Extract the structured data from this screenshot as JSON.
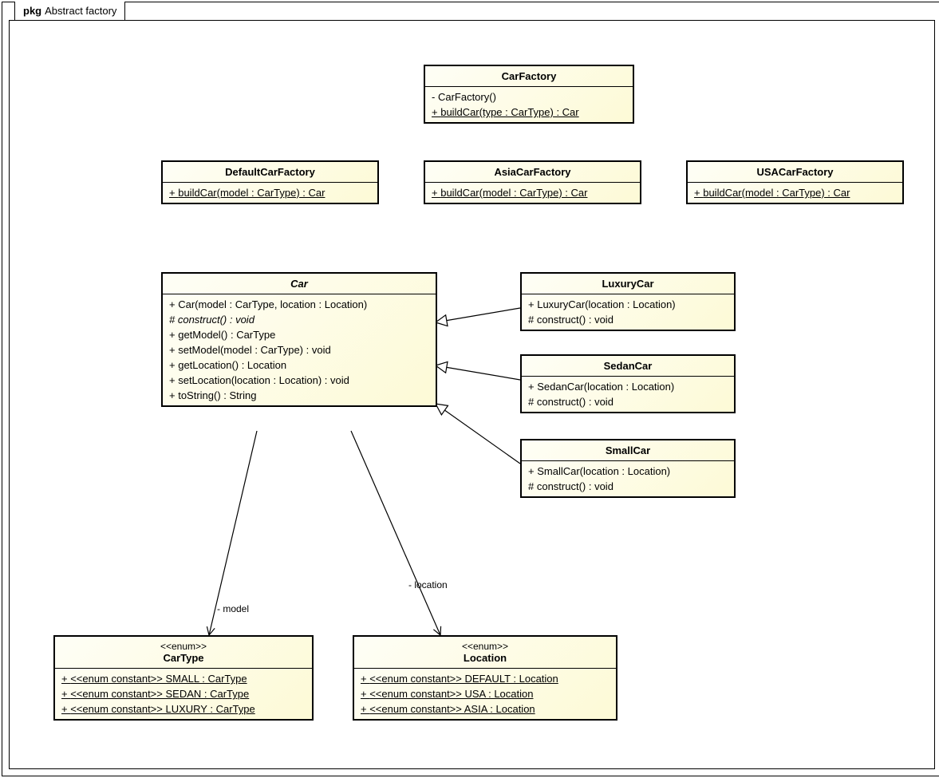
{
  "package": {
    "prefix": "pkg",
    "name": "Abstract factory"
  },
  "classes": {
    "carFactory": {
      "name": "CarFactory",
      "ops": [
        {
          "vis": "-",
          "text": "CarFactory()",
          "underline": false,
          "italic": false
        },
        {
          "vis": "+",
          "text": "buildCar(type : CarType) : Car",
          "underline": true,
          "italic": false
        }
      ]
    },
    "defaultCarFactory": {
      "name": "DefaultCarFactory",
      "ops": [
        {
          "vis": "+",
          "text": "buildCar(model : CarType) : Car",
          "underline": true,
          "italic": false
        }
      ]
    },
    "asiaCarFactory": {
      "name": "AsiaCarFactory",
      "ops": [
        {
          "vis": "+",
          "text": "buildCar(model : CarType) : Car",
          "underline": true,
          "italic": false
        }
      ]
    },
    "usaCarFactory": {
      "name": "USACarFactory",
      "ops": [
        {
          "vis": "+",
          "text": "buildCar(model : CarType) : Car",
          "underline": true,
          "italic": false
        }
      ]
    },
    "car": {
      "name": "Car",
      "italicName": true,
      "ops": [
        {
          "vis": "+",
          "text": "Car(model : CarType, location : Location)",
          "underline": false,
          "italic": false
        },
        {
          "vis": "#",
          "text": "construct() : void",
          "underline": false,
          "italic": true
        },
        {
          "vis": "+",
          "text": "getModel() : CarType",
          "underline": false,
          "italic": false
        },
        {
          "vis": "+",
          "text": "setModel(model : CarType) : void",
          "underline": false,
          "italic": false
        },
        {
          "vis": "+",
          "text": "getLocation() : Location",
          "underline": false,
          "italic": false
        },
        {
          "vis": "+",
          "text": "setLocation(location : Location) : void",
          "underline": false,
          "italic": false
        },
        {
          "vis": "+",
          "text": "toString() : String",
          "underline": false,
          "italic": false
        }
      ]
    },
    "luxuryCar": {
      "name": "LuxuryCar",
      "ops": [
        {
          "vis": "+",
          "text": "LuxuryCar(location : Location)",
          "underline": false,
          "italic": false
        },
        {
          "vis": "#",
          "text": "construct() : void",
          "underline": false,
          "italic": false
        }
      ]
    },
    "sedanCar": {
      "name": "SedanCar",
      "ops": [
        {
          "vis": "+",
          "text": "SedanCar(location : Location)",
          "underline": false,
          "italic": false
        },
        {
          "vis": "#",
          "text": "construct() : void",
          "underline": false,
          "italic": false
        }
      ]
    },
    "smallCar": {
      "name": "SmallCar",
      "ops": [
        {
          "vis": "+",
          "text": "SmallCar(location : Location)",
          "underline": false,
          "italic": false
        },
        {
          "vis": "#",
          "text": "construct() : void",
          "underline": false,
          "italic": false
        }
      ]
    },
    "carType": {
      "stereo": "<<enum>>",
      "name": "CarType",
      "ops": [
        {
          "vis": "+",
          "text": "<<enum constant>> SMALL : CarType",
          "underline": true,
          "italic": false
        },
        {
          "vis": "+",
          "text": "<<enum constant>> SEDAN : CarType",
          "underline": true,
          "italic": false
        },
        {
          "vis": "+",
          "text": "<<enum constant>> LUXURY : CarType",
          "underline": true,
          "italic": false
        }
      ]
    },
    "location": {
      "stereo": "<<enum>>",
      "name": "Location",
      "ops": [
        {
          "vis": "+",
          "text": "<<enum constant>> DEFAULT : Location",
          "underline": true,
          "italic": false
        },
        {
          "vis": "+",
          "text": "<<enum constant>> USA : Location",
          "underline": true,
          "italic": false
        },
        {
          "vis": "+",
          "text": "<<enum constant>> ASIA : Location",
          "underline": true,
          "italic": false
        }
      ]
    }
  },
  "labels": {
    "model": "- model",
    "location": "- location"
  }
}
